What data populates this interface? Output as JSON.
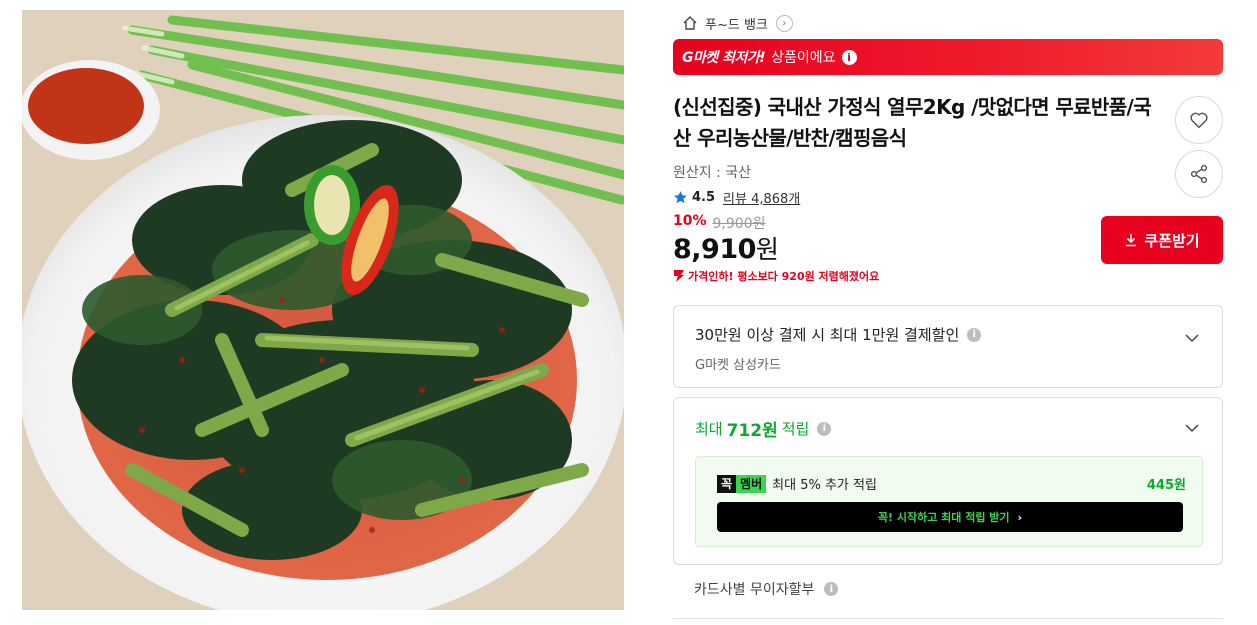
{
  "shop": {
    "name": "푸~드 뱅크",
    "home_icon": "home-icon",
    "chevron_icon": "chevron-right-icon"
  },
  "promo": {
    "strong": "G마켓 최저가!",
    "text": "상품이에요",
    "icon": "info-icon",
    "colors": {
      "banner": "#e8001f"
    }
  },
  "product": {
    "title": "(신선집중) 국내산 가정식 열무2Kg /맛없다면 무료반품/국산 우리농산물/반찬/캠핑음식",
    "origin": "원산지 : 국산",
    "rating": "4.5",
    "review_label": "리뷰",
    "review_count": "4,868개",
    "discount": "10%",
    "original_price": "9,900원",
    "price_value": "8,910",
    "price_unit": "원",
    "price_drop": "가격인하! 평소보다 920원 저렴해졌어요"
  },
  "actions": {
    "coupon_label": "쿠폰받기",
    "like_icon": "heart-icon",
    "share_icon": "share-icon",
    "download_icon": "download-icon"
  },
  "payment_benefit": {
    "title": "30만원 이상 결제 시 최대 1만원 결제할인",
    "subtitle": "G마켓 삼성카드"
  },
  "points": {
    "prefix": "최대",
    "amount": "712원",
    "suffix": "적립",
    "member_badge_1": "꼭",
    "member_badge_2": "멤버",
    "member_text": "최대 5% 추가 적립",
    "member_amount": "445원",
    "member_cta": "꼭! 시작하고 최대 적립 받기",
    "member_cta_arrow": "›"
  },
  "installment": {
    "label": "카드사별 무이자할부"
  },
  "colors": {
    "accent_red": "#e8001f",
    "points_green": "#10a72e",
    "member_green": "#3bd54e"
  }
}
